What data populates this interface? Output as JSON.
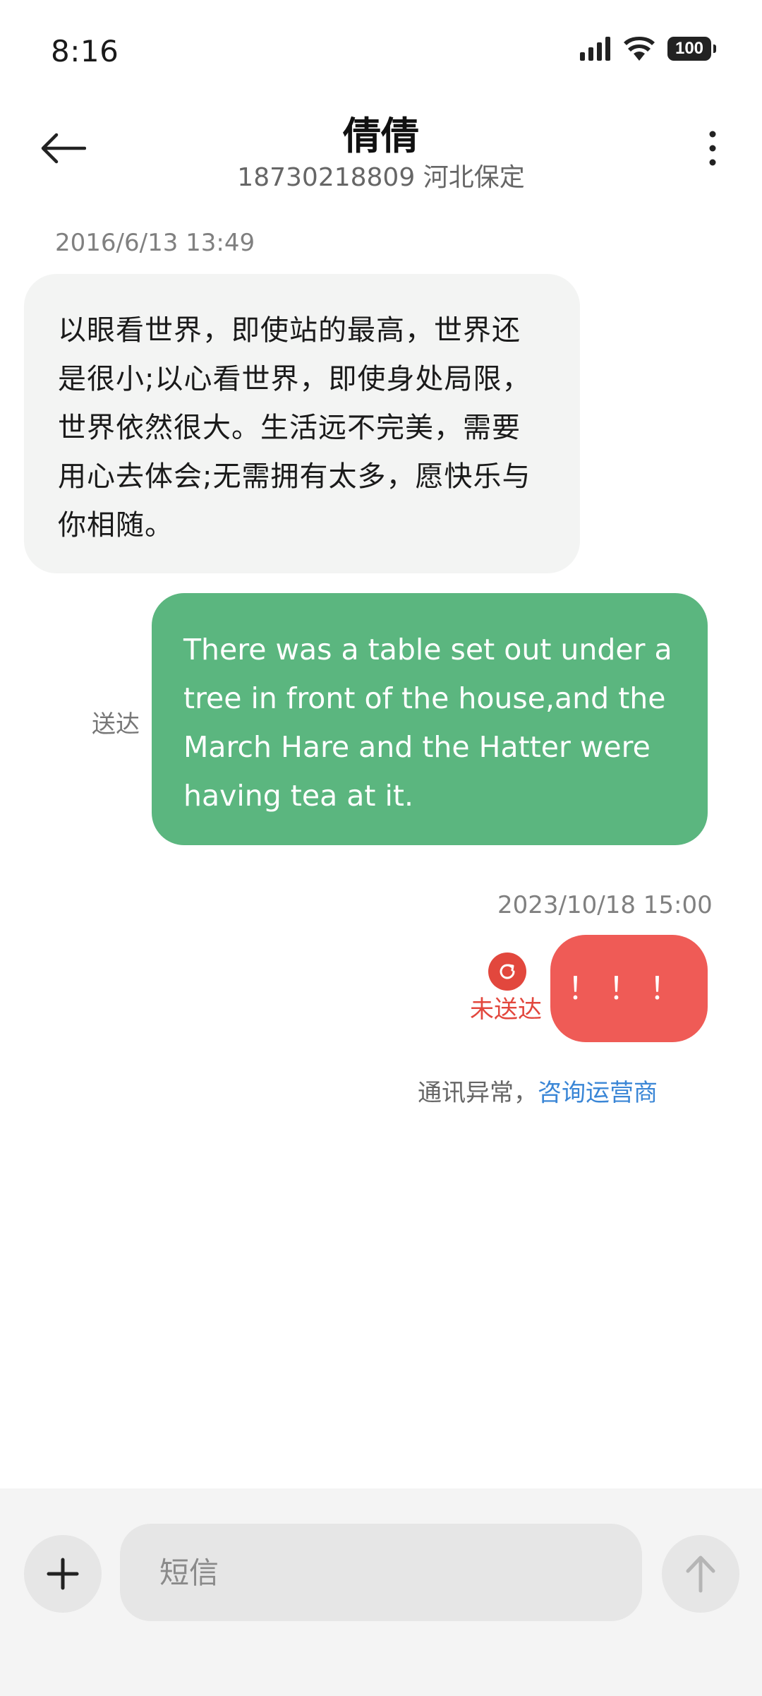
{
  "status_bar": {
    "time": "8:16",
    "battery": "100",
    "icons": [
      "signal-icon",
      "wifi-icon",
      "battery-icon"
    ]
  },
  "header": {
    "name": "倩倩",
    "subtitle": "18730218809 河北保定",
    "icons": [
      "back-arrow-icon",
      "more-vertical-icon"
    ]
  },
  "messages": [
    {
      "timestamp": "2016/6/13 13:49",
      "direction": "incoming",
      "text": "以眼看世界，即使站的最高，世界还是很小;以心看世界，即使身处局限，世界依然很大。生活远不完美，需要用心去体会;无需拥有太多，愿快乐与你相随。"
    },
    {
      "direction": "outgoing",
      "status": "送达",
      "text": "There was a table set out under a tree in front of the house,and the March Hare and the Hatter were having tea at it."
    },
    {
      "timestamp": "2023/10/18 15:00",
      "direction": "outgoing",
      "status": "未送达",
      "text": "！！！"
    }
  ],
  "notice": {
    "text": "通讯异常，",
    "link": "咨询运营商"
  },
  "composer": {
    "placeholder": "短信",
    "icons": [
      "plus-icon",
      "send-arrow-icon"
    ]
  },
  "colors": {
    "incoming_bubble": "#f3f4f3",
    "outgoing_bubble": "#5bb67f",
    "failed_bubble": "#ef5b56",
    "error_red": "#e2473d",
    "link_blue": "#3a86d6"
  }
}
